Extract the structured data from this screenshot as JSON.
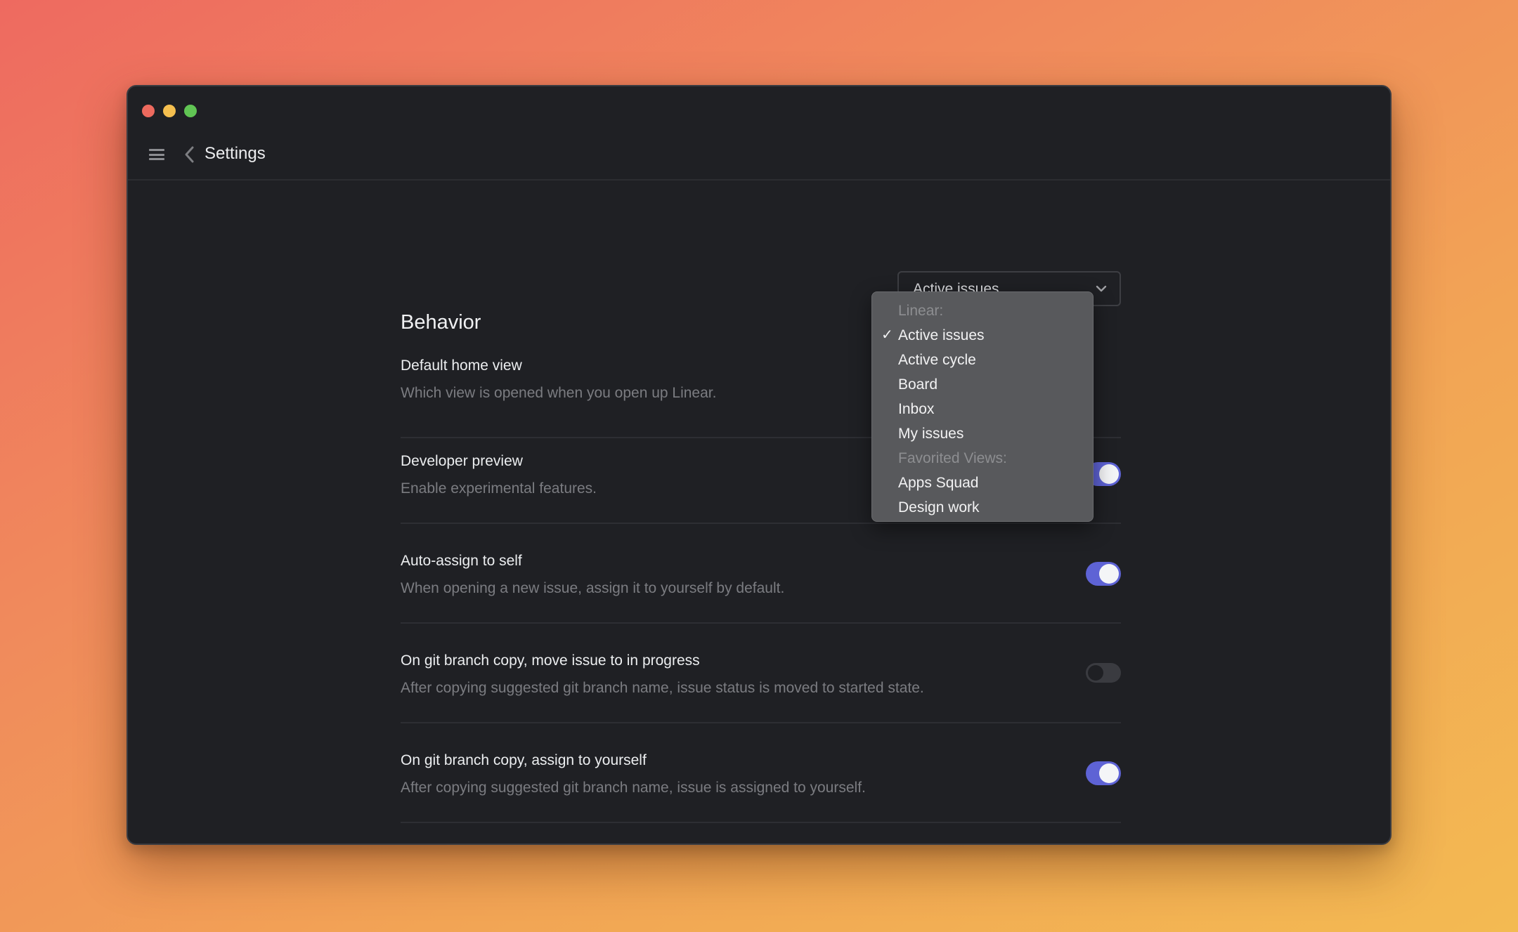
{
  "window": {
    "traffic_lights": [
      "close",
      "minimize",
      "maximize"
    ]
  },
  "header": {
    "menu_icon": "hamburger-icon",
    "back_icon": "chevron-left-icon",
    "title": "Settings"
  },
  "section": {
    "title": "Behavior"
  },
  "settings": [
    {
      "title": "Default home view",
      "description": "Which view is opened when you open up Linear.",
      "control": "select",
      "value": "Active issues"
    },
    {
      "title": "Developer preview",
      "description": "Enable experimental features.",
      "control": "toggle",
      "enabled": true
    },
    {
      "title": "Auto-assign to self",
      "description": "When opening a new issue, assign it to yourself by default.",
      "control": "toggle",
      "enabled": true
    },
    {
      "title": "On git branch copy, move issue to in progress",
      "description": "After copying suggested git branch name, issue status is moved to started state.",
      "control": "toggle",
      "enabled": false
    },
    {
      "title": "On git branch copy, assign to yourself",
      "description": "After copying suggested git branch name, issue is assigned to yourself.",
      "control": "toggle",
      "enabled": true
    }
  ],
  "dropdown": {
    "groups": [
      {
        "label": "Linear:",
        "items": [
          "Active issues",
          "Active cycle",
          "Board",
          "Inbox",
          "My issues"
        ]
      },
      {
        "label": "Favorited Views:",
        "items": [
          "Apps Squad",
          "Design work"
        ]
      }
    ],
    "selected": "Active issues",
    "check_glyph": "✓"
  },
  "colors": {
    "accent": "#5e63d5",
    "window_bg": "#1f2024",
    "menu_bg": "#58595c",
    "background_start": "#ee6a60",
    "background_end": "#f3ba52"
  }
}
